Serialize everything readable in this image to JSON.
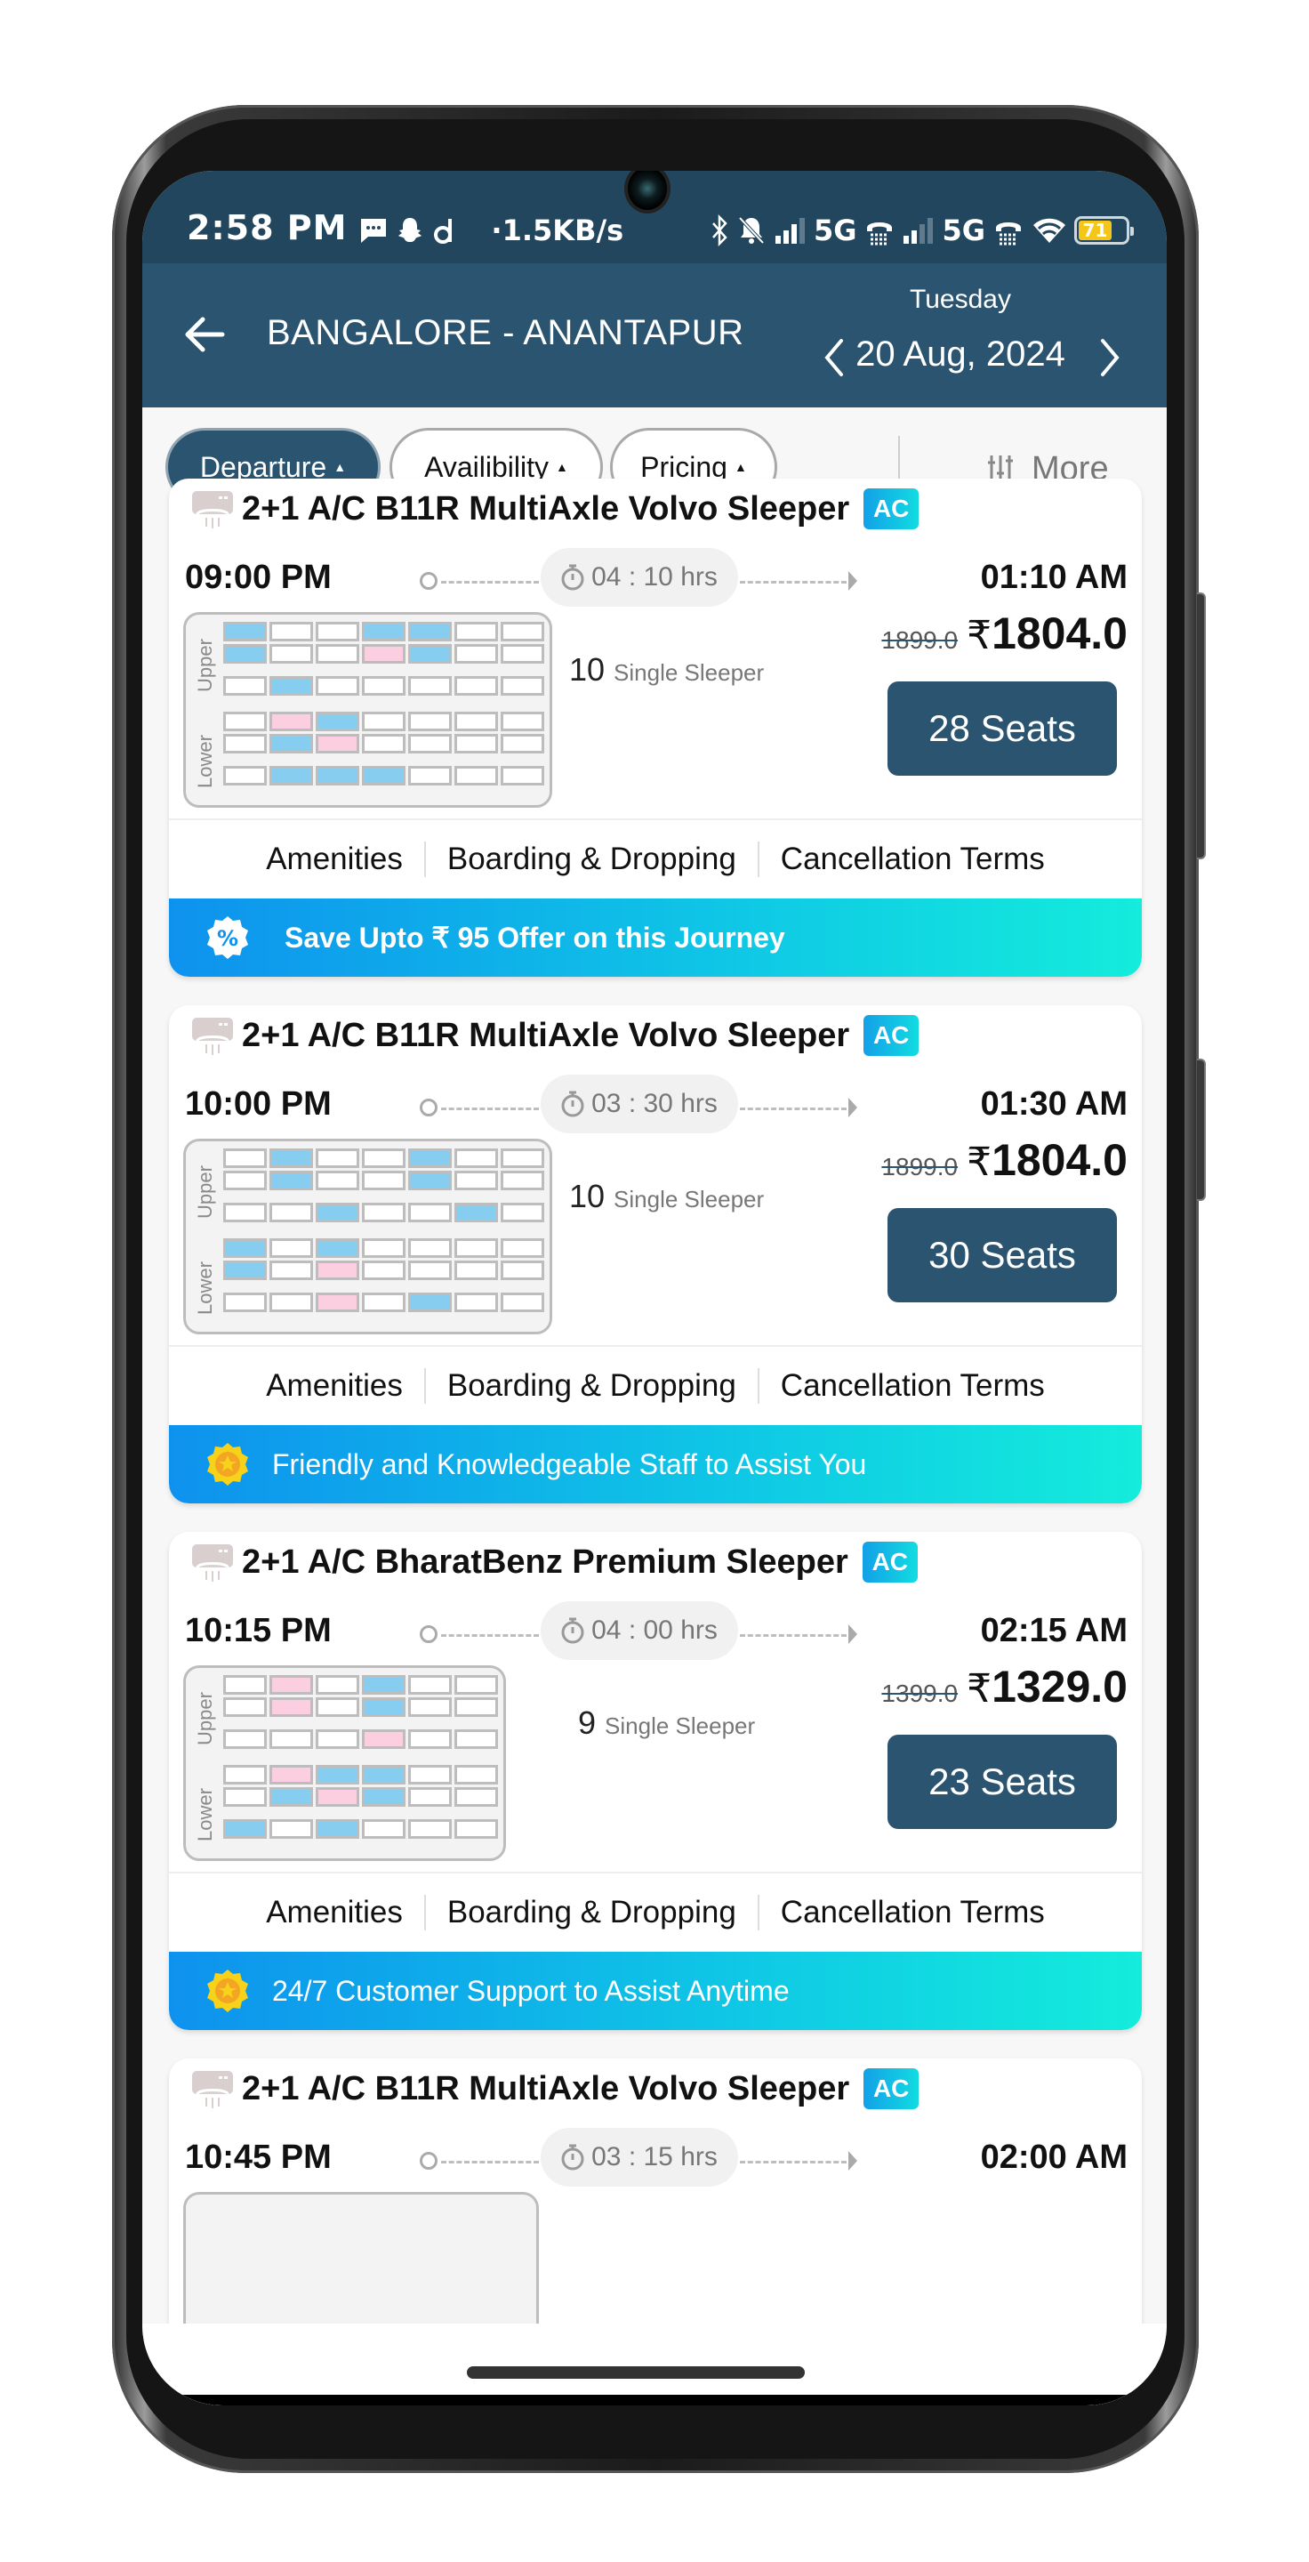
{
  "status_bar": {
    "time": "2:58 PM",
    "net_speed": "1.5KB/s",
    "network_1": "5G",
    "network_2": "5G",
    "battery": "71",
    "battery_level_percent": 71
  },
  "header": {
    "route": "BANGALORE - ANANTAPUR",
    "day": "Tuesday",
    "date": "20 Aug, 2024"
  },
  "filters": {
    "chips": [
      {
        "label": "Departure",
        "active": true
      },
      {
        "label": "Availibility",
        "active": false
      },
      {
        "label": "Pricing",
        "active": false
      }
    ],
    "more_label": "More"
  },
  "colors": {
    "primary": "#2b5470",
    "statusbar": "#22465d",
    "booked_seat": "#87cdef",
    "ladies_seat": "#fbcfe0",
    "offer_gradient_start": "#0e92ee",
    "offer_gradient_end": "#14ecdc"
  },
  "links": {
    "amenities": "Amenities",
    "boarding": "Boarding & Dropping",
    "cancellation": "Cancellation Terms"
  },
  "legend": {
    "upper": "Upper",
    "lower": "Lower",
    "ac_badge": "AC"
  },
  "buses": [
    {
      "title": "2+1 A/C B11R MultiAxle Volvo Sleeper",
      "departure": "09:00 PM",
      "arrival": "01:10 AM",
      "duration": "04 : 10 hrs",
      "sleeper_count": "10",
      "sleeper_label": "Single Sleeper",
      "old_price": "1899.0",
      "price": "1804.0",
      "currency": "₹",
      "seats": "28 Seats",
      "offer": "Save Upto ₹ 95 Offer on this Journey",
      "offer_icon": "discount-badge-icon",
      "seat_map": {
        "upper": [
          [
            "b",
            "e",
            "e",
            "b",
            "b",
            "e",
            "e"
          ],
          [
            "b",
            "e",
            "e",
            "l",
            "b",
            "e",
            "e"
          ],
          [
            "e",
            "b",
            "e",
            "e",
            "e",
            "e",
            "e"
          ]
        ],
        "lower": [
          [
            "e",
            "l",
            "b",
            "e",
            "e",
            "e",
            "e"
          ],
          [
            "e",
            "b",
            "l",
            "e",
            "e",
            "e",
            "e"
          ],
          [
            "e",
            "b",
            "b",
            "b",
            "e",
            "e",
            "e"
          ]
        ]
      }
    },
    {
      "title": "2+1 A/C B11R MultiAxle Volvo Sleeper",
      "departure": "10:00 PM",
      "arrival": "01:30 AM",
      "duration": "03 : 30 hrs",
      "sleeper_count": "10",
      "sleeper_label": "Single Sleeper",
      "old_price": "1899.0",
      "price": "1804.0",
      "currency": "₹",
      "seats": "30 Seats",
      "offer": "Friendly and Knowledgeable Staff to Assist You",
      "offer_icon": "star-medal-icon",
      "seat_map": {
        "upper": [
          [
            "e",
            "b",
            "e",
            "e",
            "b",
            "e",
            "e"
          ],
          [
            "e",
            "b",
            "e",
            "e",
            "b",
            "e",
            "e"
          ],
          [
            "e",
            "e",
            "b",
            "e",
            "e",
            "b",
            "e"
          ]
        ],
        "lower": [
          [
            "b",
            "e",
            "b",
            "e",
            "e",
            "e",
            "e"
          ],
          [
            "b",
            "e",
            "l",
            "e",
            "e",
            "e",
            "e"
          ],
          [
            "e",
            "e",
            "l",
            "e",
            "b",
            "e",
            "e"
          ]
        ]
      }
    },
    {
      "title": "2+1 A/C BharatBenz Premium Sleeper",
      "departure": "10:15 PM",
      "arrival": "02:15 AM",
      "duration": "04 : 00 hrs",
      "sleeper_count": "9",
      "sleeper_label": "Single Sleeper",
      "old_price": "1399.0",
      "price": "1329.0",
      "currency": "₹",
      "seats": "23 Seats",
      "offer": "24/7 Customer Support to Assist Anytime",
      "offer_icon": "star-medal-icon",
      "seat_map": {
        "upper": [
          [
            "e",
            "l",
            "e",
            "b",
            "e",
            "e"
          ],
          [
            "e",
            "l",
            "e",
            "b",
            "e",
            "e"
          ],
          [
            "e",
            "e",
            "e",
            "l",
            "e",
            "e"
          ]
        ],
        "lower": [
          [
            "e",
            "l",
            "b",
            "b",
            "e",
            "e"
          ],
          [
            "e",
            "b",
            "l",
            "b",
            "e",
            "e"
          ],
          [
            "b",
            "e",
            "b",
            "e",
            "e",
            "e"
          ]
        ]
      }
    },
    {
      "title": "2+1 A/C B11R MultiAxle Volvo Sleeper",
      "departure": "10:45 PM",
      "arrival": "02:00 AM",
      "duration": "03 : 15 hrs"
    }
  ]
}
